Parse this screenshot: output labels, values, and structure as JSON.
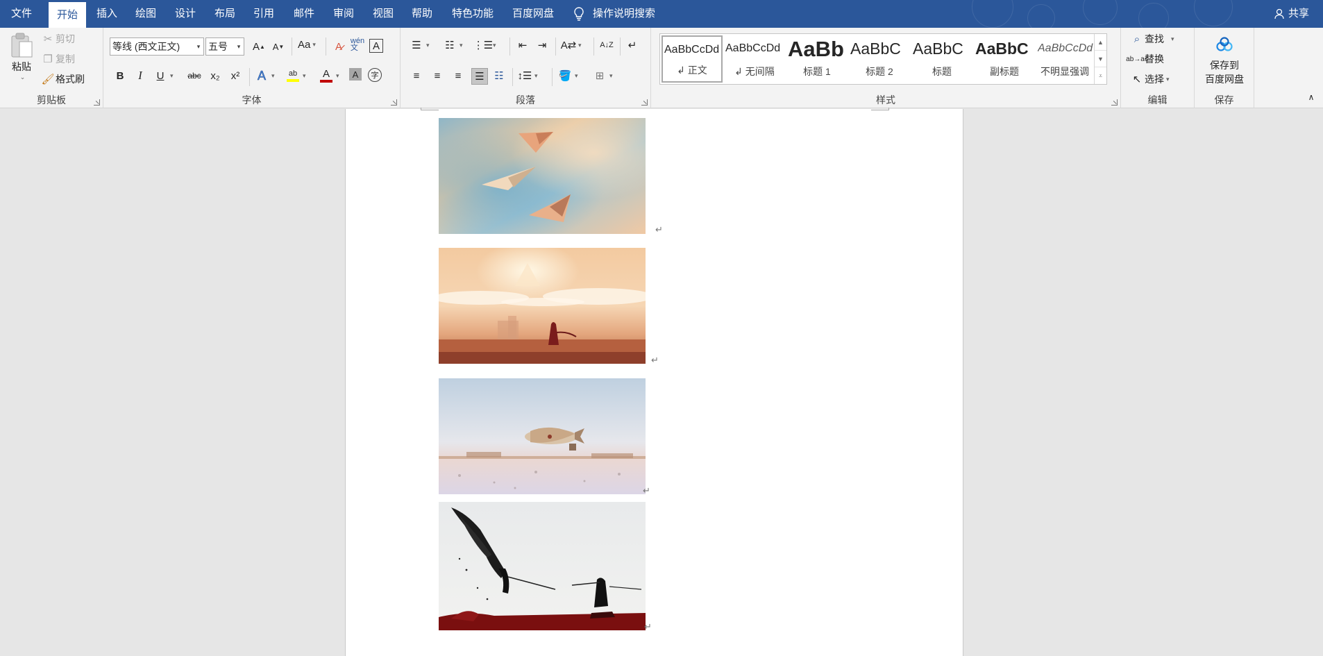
{
  "tabs": [
    {
      "label": "文件",
      "active": false
    },
    {
      "label": "开始",
      "active": true
    },
    {
      "label": "插入",
      "active": false
    },
    {
      "label": "绘图",
      "active": false
    },
    {
      "label": "设计",
      "active": false
    },
    {
      "label": "布局",
      "active": false
    },
    {
      "label": "引用",
      "active": false
    },
    {
      "label": "邮件",
      "active": false
    },
    {
      "label": "审阅",
      "active": false
    },
    {
      "label": "视图",
      "active": false
    },
    {
      "label": "帮助",
      "active": false
    },
    {
      "label": "特色功能",
      "active": false
    },
    {
      "label": "百度网盘",
      "active": false
    }
  ],
  "tell_me": "操作说明搜索",
  "share": "共享",
  "clipboard": {
    "paste": "粘贴",
    "cut": "剪切",
    "copy": "复制",
    "format_painter": "格式刷",
    "label": "剪贴板"
  },
  "font": {
    "font_name": "等线 (西文正文)",
    "font_size": "五号",
    "change_case": "Aa",
    "bold": "B",
    "italic": "I",
    "underline": "U",
    "strike": "abc",
    "subscript": "x₂",
    "superscript": "x²",
    "label": "字体",
    "font_color": "#c00000",
    "highlight_color": "#ffff00"
  },
  "paragraph": {
    "label": "段落"
  },
  "styles": {
    "label": "样式",
    "items": [
      {
        "sample": "AaBbCcDd",
        "name": "↲ 正文",
        "selected": true
      },
      {
        "sample": "AaBbCcDd",
        "name": "↲ 无间隔",
        "selected": false
      },
      {
        "sample": "AaBb",
        "name": "标题 1",
        "selected": false
      },
      {
        "sample": "AaBbC",
        "name": "标题 2",
        "selected": false
      },
      {
        "sample": "AaBbC",
        "name": "标题",
        "selected": false
      },
      {
        "sample": "AaBbC",
        "name": "副标题",
        "selected": false
      },
      {
        "sample": "AaBbCcDd",
        "name": "不明显强调",
        "selected": false
      }
    ]
  },
  "editing": {
    "find": "查找",
    "replace": "替换",
    "select": "选择",
    "label": "编辑"
  },
  "save": {
    "button": "保存到\n百度网盘",
    "line1": "保存到",
    "line2": "百度网盘",
    "label": "保存"
  },
  "document": {
    "images": [
      {
        "name": "paper-planes-in-sky"
      },
      {
        "name": "desert-journey-traveler"
      },
      {
        "name": "airship-over-desert"
      },
      {
        "name": "winged-swordsmen-duel"
      }
    ],
    "paragraph_mark": "↵"
  },
  "colors": {
    "brand": "#2b579a",
    "ribbon_bg": "#f3f3f3",
    "doc_bg": "#e6e6e6"
  }
}
